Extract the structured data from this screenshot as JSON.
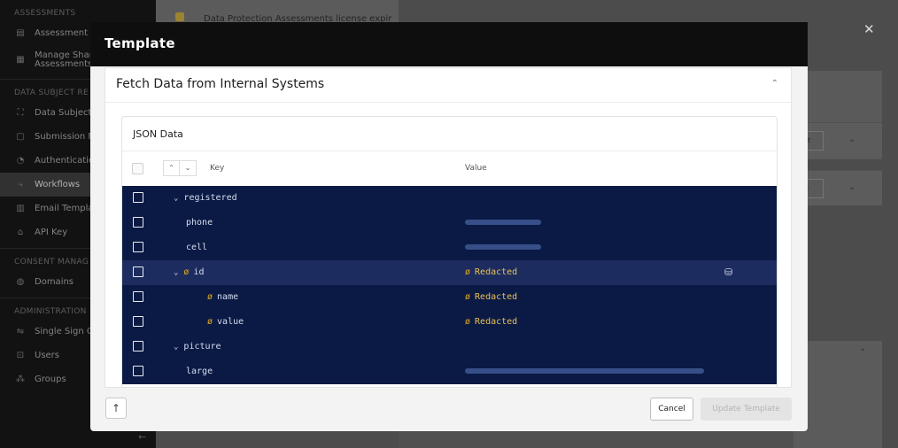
{
  "sidebar": {
    "sections": [
      {
        "title": "ASSESSMENTS",
        "items": [
          {
            "label": "Assessment T",
            "icon": "document-icon",
            "icon_char": "▤"
          },
          {
            "label": "Manage Shar Assessments",
            "icon": "shared-assessment-icon",
            "icon_char": "▦"
          }
        ]
      },
      {
        "title": "DATA SUBJECT RE",
        "items": [
          {
            "label": "Data Subject",
            "icon": "data-subject-icon",
            "icon_char": "⛶"
          },
          {
            "label": "Submission F",
            "icon": "submission-form-icon",
            "icon_char": "▢"
          },
          {
            "label": "Authenticatio",
            "icon": "authentication-icon",
            "icon_char": "◔"
          },
          {
            "label": "Workflows",
            "icon": "workflow-icon",
            "icon_char": "⤷",
            "active": true
          },
          {
            "label": "Email Templa",
            "icon": "email-template-icon",
            "icon_char": "▥"
          },
          {
            "label": "API Key",
            "icon": "lock-icon",
            "icon_char": "⌂"
          }
        ]
      },
      {
        "title": "CONSENT MANAG",
        "items": [
          {
            "label": "Domains",
            "icon": "globe-icon",
            "icon_char": "◍"
          }
        ]
      },
      {
        "title": "ADMINISTRATION",
        "items": [
          {
            "label": "Single Sign O",
            "icon": "sso-icon",
            "icon_char": "⇋"
          },
          {
            "label": "Users",
            "icon": "users-icon",
            "icon_char": "⊡"
          },
          {
            "label": "Groups",
            "icon": "groups-icon",
            "icon_char": "⁂"
          }
        ]
      }
    ],
    "collapse_icon": "←"
  },
  "background": {
    "banner_text": "Data Protection Assessments license expir",
    "pill_1": "ader",
    "pill_2": "ram"
  },
  "close_icon": "✕",
  "modal": {
    "title": "Template",
    "section_title": "Fetch Data from Internal Systems",
    "section_chevron": "⌃",
    "json_title": "JSON Data",
    "header": {
      "sort_up": "⌃",
      "sort_down": "⌄",
      "key": "Key",
      "value": "Value"
    },
    "rows": [
      {
        "key": "registered",
        "indent": 1,
        "caret": "⌄",
        "hidden": false,
        "value_type": "none",
        "value": ""
      },
      {
        "key": "phone",
        "indent": 2,
        "caret": "",
        "hidden": false,
        "value_type": "blur",
        "value": "",
        "blur_width": 86
      },
      {
        "key": "cell",
        "indent": 2,
        "caret": "",
        "hidden": false,
        "value_type": "blur",
        "value": "",
        "blur_width": 86
      },
      {
        "key": "id",
        "indent": 1,
        "caret": "⌄",
        "hidden": true,
        "value_type": "redacted",
        "value": "Redacted",
        "selected": true,
        "action_icon": "⛁"
      },
      {
        "key": "name",
        "indent": 3,
        "caret": "",
        "hidden": true,
        "value_type": "redacted",
        "value": "Redacted"
      },
      {
        "key": "value",
        "indent": 3,
        "caret": "",
        "hidden": true,
        "value_type": "redacted",
        "value": "Redacted"
      },
      {
        "key": "picture",
        "indent": 1,
        "caret": "⌄",
        "hidden": false,
        "value_type": "none",
        "value": ""
      },
      {
        "key": "large",
        "indent": 2,
        "caret": "",
        "hidden": false,
        "value_type": "blur",
        "value": "",
        "blur_width": 270
      }
    ],
    "hidden_icon_char": "ø",
    "footer": {
      "up_icon": "↑",
      "cancel_label": "Cancel",
      "update_label": "Update Template"
    }
  },
  "colors": {
    "row_bg": "#0b1a44",
    "row_selected_bg": "#1c2c5e",
    "redacted": "#e8c15a",
    "hidden_icon": "#e0a81e"
  }
}
